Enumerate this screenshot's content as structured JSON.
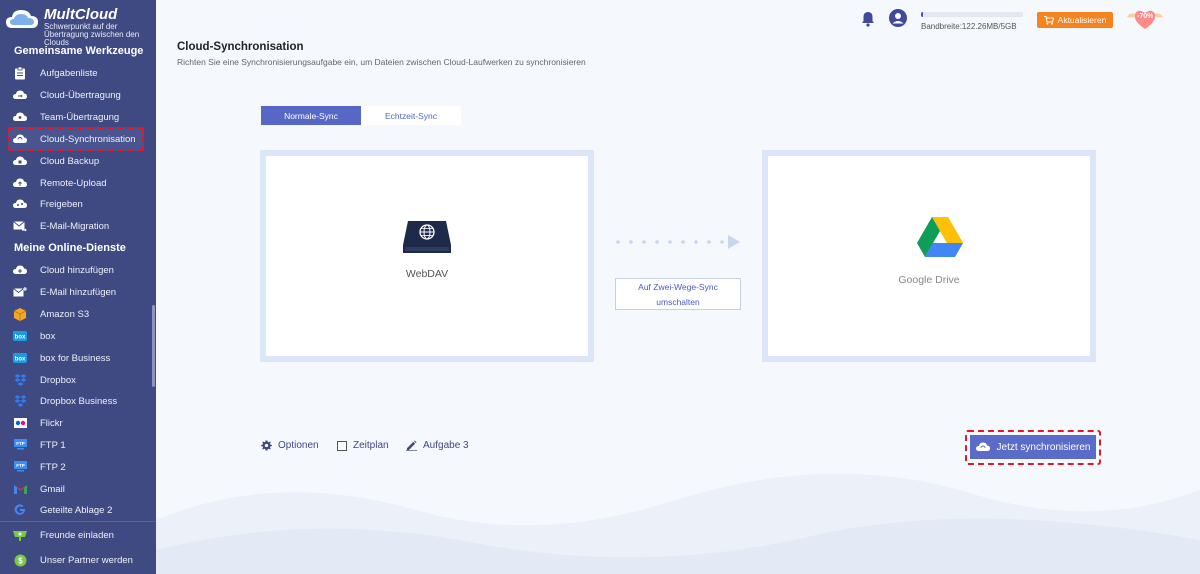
{
  "brand": {
    "name": "MultCloud",
    "tagline": "Schwerpunkt auf der Übertragung zwischen den Clouds"
  },
  "sidebar": {
    "section1_title": "Gemeinsame Werkzeuge",
    "section1_items": [
      {
        "label": "Aufgabenliste",
        "icon": "clipboard-icon"
      },
      {
        "label": "Cloud-Übertragung",
        "icon": "cloud-transfer-icon"
      },
      {
        "label": "Team-Übertragung",
        "icon": "team-transfer-icon"
      },
      {
        "label": "Cloud-Synchronisation",
        "icon": "cloud-sync-icon",
        "active": true
      },
      {
        "label": "Cloud Backup",
        "icon": "cloud-backup-icon"
      },
      {
        "label": "Remote-Upload",
        "icon": "remote-upload-icon"
      },
      {
        "label": "Freigeben",
        "icon": "share-icon"
      },
      {
        "label": "E-Mail-Migration",
        "icon": "email-migration-icon"
      }
    ],
    "section2_title": "Meine Online-Dienste",
    "section2_items": [
      {
        "label": "Cloud hinzufügen",
        "icon": "add-cloud-icon"
      },
      {
        "label": "E-Mail hinzufügen",
        "icon": "add-email-icon"
      },
      {
        "label": "Amazon S3",
        "icon": "amazon-s3-icon"
      },
      {
        "label": "box",
        "icon": "box-icon"
      },
      {
        "label": "box for Business",
        "icon": "box-business-icon"
      },
      {
        "label": "Dropbox",
        "icon": "dropbox-icon"
      },
      {
        "label": "Dropbox Business",
        "icon": "dropbox-business-icon"
      },
      {
        "label": "Flickr",
        "icon": "flickr-icon"
      },
      {
        "label": "FTP 1",
        "icon": "ftp-icon"
      },
      {
        "label": "FTP 2",
        "icon": "ftp-icon"
      },
      {
        "label": "Gmail",
        "icon": "gmail-icon"
      },
      {
        "label": "Geteilte Ablage 2",
        "icon": "google-shared-drive-icon"
      }
    ],
    "footer_items": [
      {
        "label": "Freunde einladen",
        "icon": "invite-friends-icon"
      },
      {
        "label": "Unser Partner werden",
        "icon": "partner-icon"
      }
    ]
  },
  "topbar": {
    "bandwidth_label": "Bandbreite:122.26MB/5GB",
    "bandwidth_fraction": 0.024,
    "upgrade_label": "Aktualisieren",
    "promo_label": "-70%"
  },
  "main": {
    "title": "Cloud-Synchronisation",
    "subtitle": "Richten Sie eine Synchronisierungsaufgabe ein, um Dateien zwischen Cloud-Laufwerken zu synchronisieren",
    "tabs": [
      {
        "label": "Normale-Sync",
        "active": true
      },
      {
        "label": "Echtzeit-Sync",
        "active": false
      }
    ],
    "source_label": "WebDAV",
    "target_label": "Google Drive",
    "toggle_line1": "Auf Zwei-Wege-Sync",
    "toggle_line2": "umschalten",
    "options_label": "Optionen",
    "schedule_label": "Zeitplan",
    "task_label": "Aufgabe 3",
    "sync_now_label": "Jetzt synchronisieren"
  },
  "colors": {
    "sidebar_bg": "#3f4a82",
    "accent": "#5667c6",
    "highlight_border": "#e0192a",
    "upgrade_bg": "#f5831f"
  }
}
